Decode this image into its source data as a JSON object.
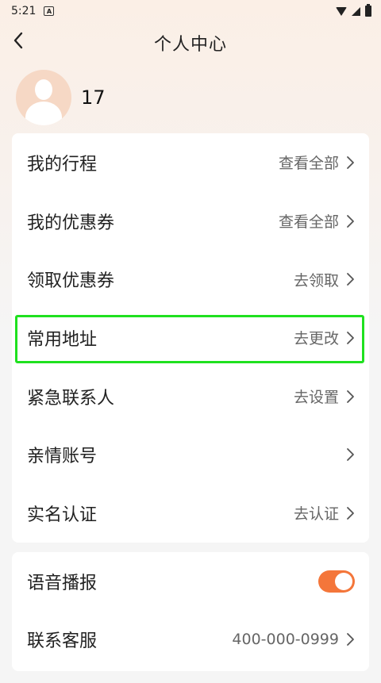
{
  "status_bar": {
    "time": "5:21",
    "notif_glyph": "A"
  },
  "header": {
    "title": "个人中心"
  },
  "profile": {
    "name": "17"
  },
  "menu": [
    {
      "label": "我的行程",
      "value": "查看全部"
    },
    {
      "label": "我的优惠券",
      "value": "查看全部"
    },
    {
      "label": "领取优惠券",
      "value": "去领取"
    },
    {
      "label": "常用地址",
      "value": "去更改"
    },
    {
      "label": "紧急联系人",
      "value": "去设置"
    },
    {
      "label": "亲情账号",
      "value": ""
    },
    {
      "label": "实名认证",
      "value": "去认证"
    }
  ],
  "settings": {
    "voice": {
      "label": "语音播报",
      "enabled": true
    },
    "service": {
      "label": "联系客服",
      "value": "400-000-0999"
    }
  },
  "colors": {
    "accent": "#f4763a",
    "highlight": "#1fe11f",
    "avatar_bg": "#f6d8c5"
  },
  "icons": {
    "back": "chevron-left-icon",
    "row_arrow": "chevron-right-icon",
    "wifi": "wifi-icon",
    "cell": "cell-signal-icon",
    "battery": "battery-icon"
  }
}
